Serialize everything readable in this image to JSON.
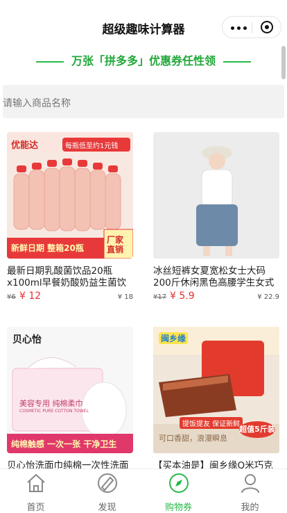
{
  "header": {
    "title": "超级趣味计算器"
  },
  "promo": {
    "text": "万张「拼多多」优惠券任性领"
  },
  "search": {
    "placeholder": "请输入商品名称"
  },
  "products": [
    {
      "title": "最新日期乳酸菌饮品20瓶x100ml早餐奶酸奶益生菌饮",
      "old_price": "¥6",
      "price": "¥ 12",
      "sales": "¥ 18",
      "img_top_text": "优能达",
      "img_badge": "每瓶低至约1元钱",
      "img_bottom_text": "新鲜日期 整箱20瓶",
      "img_corner": "厂家直销"
    },
    {
      "title": "冰丝短裤女夏宽松女士大码200斤休闲黑色高腰学生女式",
      "old_price": "¥17",
      "price": "¥ 5.9",
      "sales": "¥ 22.9"
    },
    {
      "title": "贝心怡洗面巾纯棉一次性洗面",
      "img_brand": "贝心怡",
      "img_box_text": "美容专用 纯棉柔巾",
      "img_box_sub": "COSMETIC PURE COTTON TOWEL",
      "img_bottom_text": "纯棉触感 一次一张 干净卫生"
    },
    {
      "title": "【买本油是】闽乡缘Q米巧克",
      "img_brand": "闽乡缘",
      "img_tag": "提饭提友 保证新鲜",
      "img_bottom_text": "可口香甜，浪漫瞬息",
      "img_corner": "超值5斤装"
    }
  ],
  "tabs": [
    {
      "label": "首页",
      "icon": "home-icon"
    },
    {
      "label": "发现",
      "icon": "discover-icon"
    },
    {
      "label": "购物券",
      "icon": "compass-icon",
      "active": true
    },
    {
      "label": "我的",
      "icon": "user-icon"
    }
  ],
  "colors": {
    "accent": "#2bb84a",
    "price": "#e53030"
  }
}
